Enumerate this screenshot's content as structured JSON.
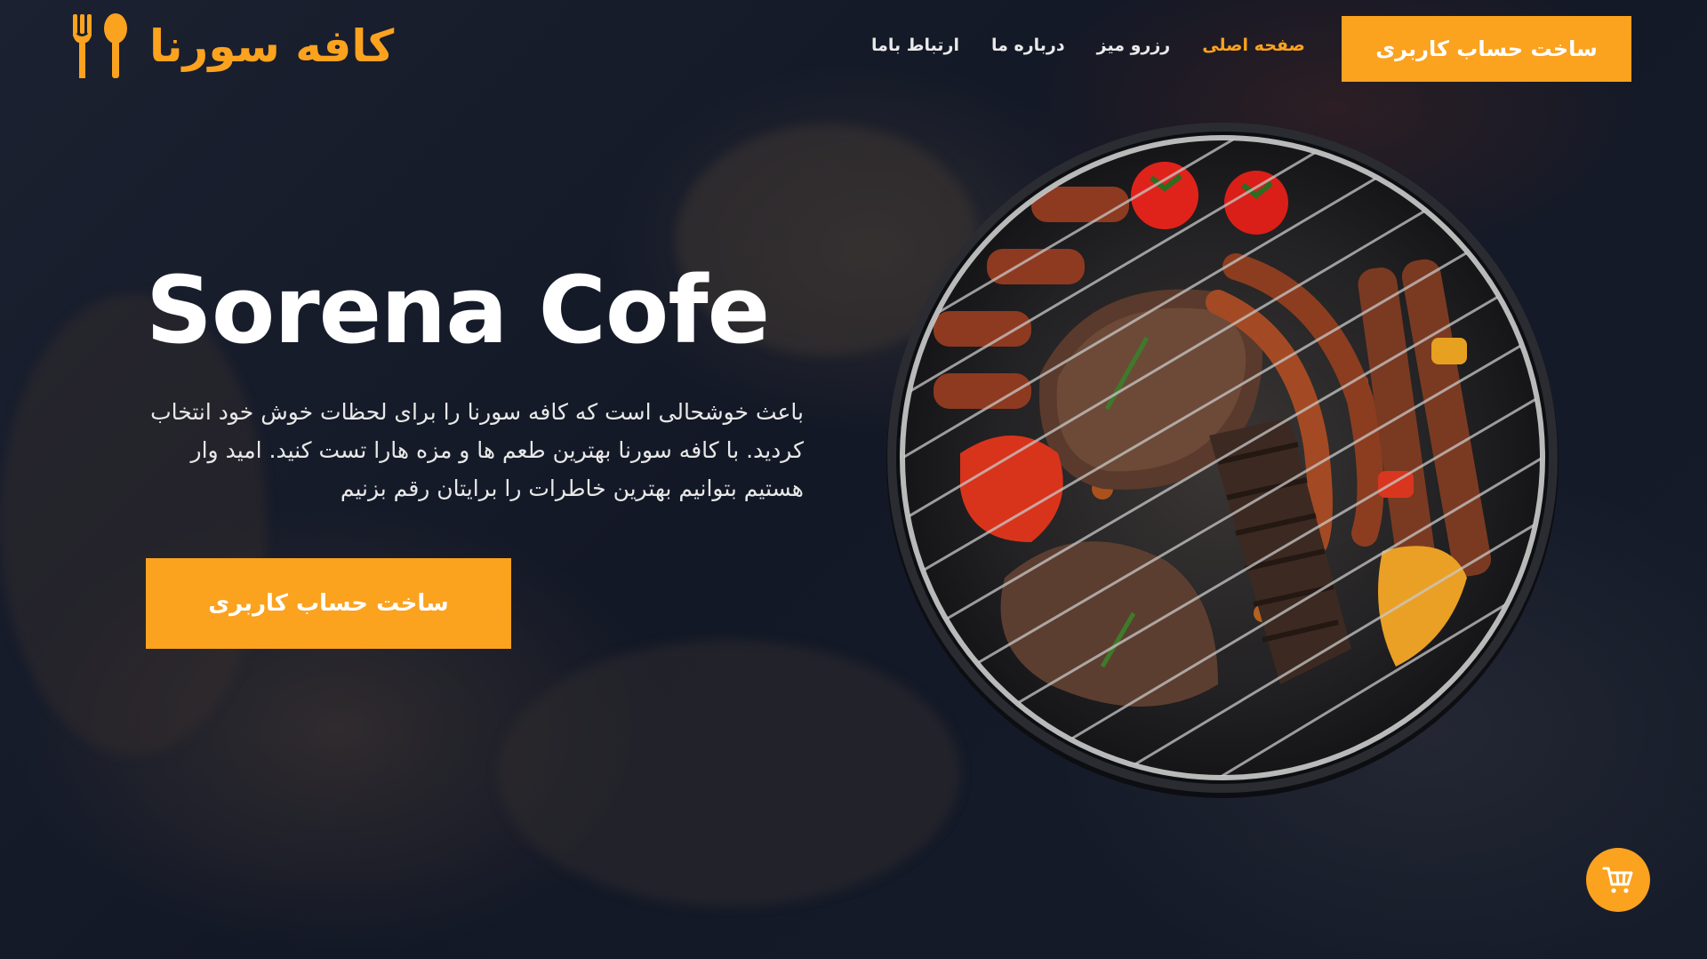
{
  "brand": {
    "name": "کافه سورنا",
    "accent_color": "#fba21f",
    "logo_icon": "fork-spoon-icon"
  },
  "nav": {
    "items": [
      {
        "label": "ارتباط باما",
        "active": false
      },
      {
        "label": "درباره ما",
        "active": false
      },
      {
        "label": "رزرو میز",
        "active": false
      },
      {
        "label": "صفحه اصلی",
        "active": true
      }
    ]
  },
  "header": {
    "signup_label": "ساخت حساب کاربری"
  },
  "hero": {
    "title": "Sorena Cofe",
    "description": "باعث خوشحالی است که کافه سورنا را برای لحظات خوش خود انتخاب کردید. با کافه سورنا بهترین طعم ها و مزه هارا تست کنید. امید وار هستیم بتوانیم بهترین خاطرات را برایتان رقم بزنیم",
    "cta_label": "ساخت حساب کاربری",
    "image": "barbecue-grill-image"
  },
  "cart": {
    "icon": "shopping-cart-icon"
  }
}
